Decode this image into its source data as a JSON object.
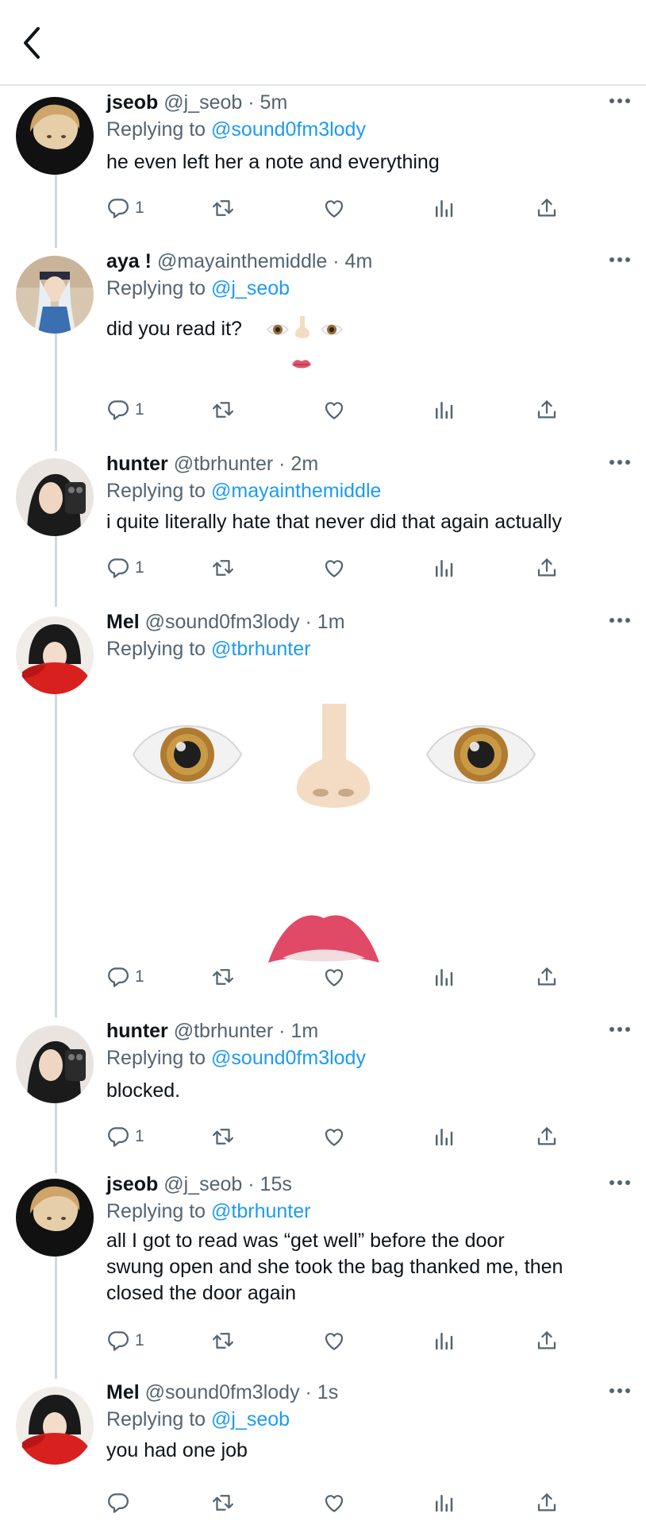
{
  "colors": {
    "accent": "#1d9bf0",
    "muted": "#536471",
    "text": "#0f1419",
    "thread_line": "#cfd9de"
  },
  "header": {
    "back_icon": "chevron-left-icon"
  },
  "tweets": [
    {
      "name": "jseob",
      "handle": "@j_seob",
      "time": "· 5m",
      "replying_label": "Replying to ",
      "replying_to": "@sound0fm3lody",
      "text": "he even left her a note and everything",
      "reply_count": "1"
    },
    {
      "name": "aya !",
      "handle": "@mayainthemiddle",
      "time": "· 4m",
      "replying_label": "Replying to ",
      "replying_to": "@j_seob",
      "text": "did you read it?",
      "reply_count": "1"
    },
    {
      "name": "hunter",
      "handle": "@tbrhunter",
      "time": "· 2m",
      "replying_label": "Replying to ",
      "replying_to": "@mayainthemiddle",
      "text": "i quite literally hate that never did that again actually",
      "reply_count": "1"
    },
    {
      "name": "Mel",
      "handle": "@sound0fm3lody",
      "time": "· 1m",
      "replying_label": "Replying to ",
      "replying_to": "@tbrhunter",
      "text": "",
      "reply_count": "1"
    },
    {
      "name": "hunter",
      "handle": "@tbrhunter",
      "time": "· 1m",
      "replying_label": "Replying to ",
      "replying_to": "@sound0fm3lody",
      "text": "blocked.",
      "reply_count": "1"
    },
    {
      "name": "jseob",
      "handle": "@j_seob",
      "time": "· 15s",
      "replying_label": "Replying to ",
      "replying_to": "@tbrhunter",
      "text": "all I got to read was “get well” before the door\nswung open and she took the bag thanked me, then\nclosed the  door again",
      "reply_count": "1"
    },
    {
      "name": "Mel",
      "handle": "@sound0fm3lody",
      "time": "· 1s",
      "replying_label": "Replying to ",
      "replying_to": "@j_seob",
      "text": "you had one job",
      "reply_count": ""
    }
  ]
}
